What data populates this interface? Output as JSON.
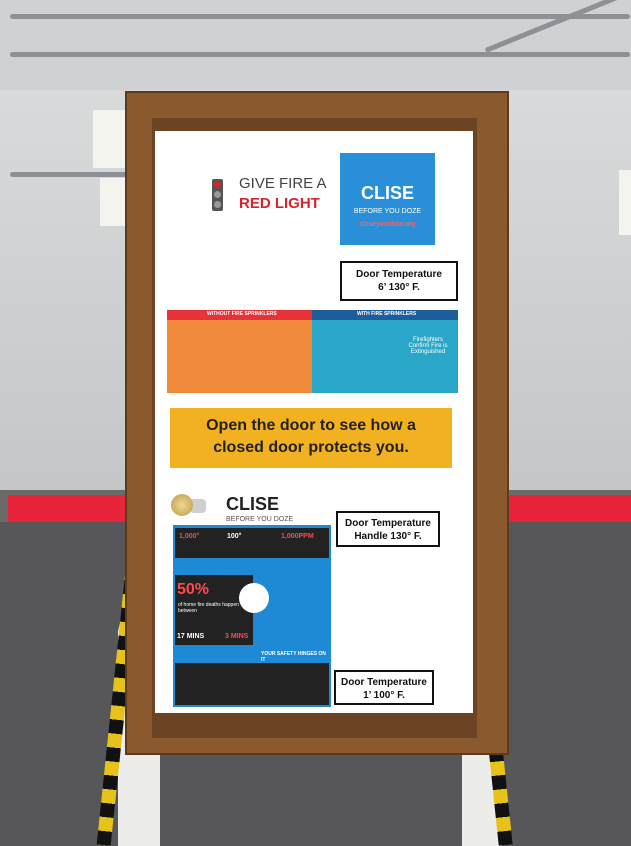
{
  "sign_top": {
    "line1": "GIVE FIRE A",
    "line2": "RED LIGHT"
  },
  "close_logo": {
    "title": "CLISE",
    "subtitle": "BEFORE YOU DOZE",
    "url": "closeyourdoor.org"
  },
  "temp_top": {
    "line1": "Door Temperature",
    "line2": "6’   130° F."
  },
  "sprinkler_panel": {
    "left_label": "WITHOUT FIRE SPRINKLERS",
    "right_label": "WITH FIRE SPRINKLERS",
    "note": "Firefighters Confirm Fire is Extinguished"
  },
  "open_sign": {
    "line1": "Open the door to see how a",
    "line2": "closed door protects you."
  },
  "close_logo_2": {
    "title": "CLISE",
    "subtitle": "BEFORE YOU DOZE"
  },
  "temp_handle": {
    "line1": "Door Temperature",
    "line2": "Handle    130° F."
  },
  "infographic": {
    "stat1": "1,000°",
    "stat2": "100°",
    "stat3": "1,000PPM",
    "percent": "50%",
    "percent_text": "of home fire deaths happen between",
    "timer1": "17 MINS",
    "timer2": "3 MINS",
    "footer": "YOUR SAFETY HINGES ON IT"
  },
  "temp_bottom": {
    "line1": "Door Temperature",
    "line2": "1’    100° F."
  },
  "colors": {
    "red_light": "#d8222e",
    "close_blue": "#2a8fd9",
    "open_sign_yellow": "#f2b120",
    "tent_band_red": "#e8243a"
  }
}
